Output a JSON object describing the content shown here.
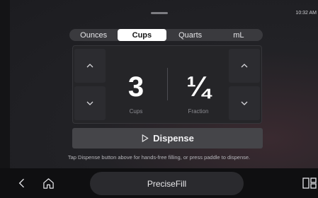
{
  "status": {
    "time": "10:32 AM"
  },
  "units": {
    "options": [
      "Ounces",
      "Cups",
      "Quarts",
      "mL"
    ],
    "selected": "Cups"
  },
  "amount": {
    "whole_value": "3",
    "whole_label": "Cups",
    "fraction_value": "¼",
    "fraction_label": "Fraction"
  },
  "actions": {
    "dispense_label": "Dispense"
  },
  "hint": "Tap Dispense button above for hands-free filling, or press paddle to dispense.",
  "bottom_bar": {
    "app_name": "PreciseFill",
    "icons": [
      "back-icon",
      "home-icon",
      "apps-icon"
    ]
  },
  "colors": {
    "accent_selected": "#ffffff",
    "button": "#454549",
    "background": "#222226"
  }
}
